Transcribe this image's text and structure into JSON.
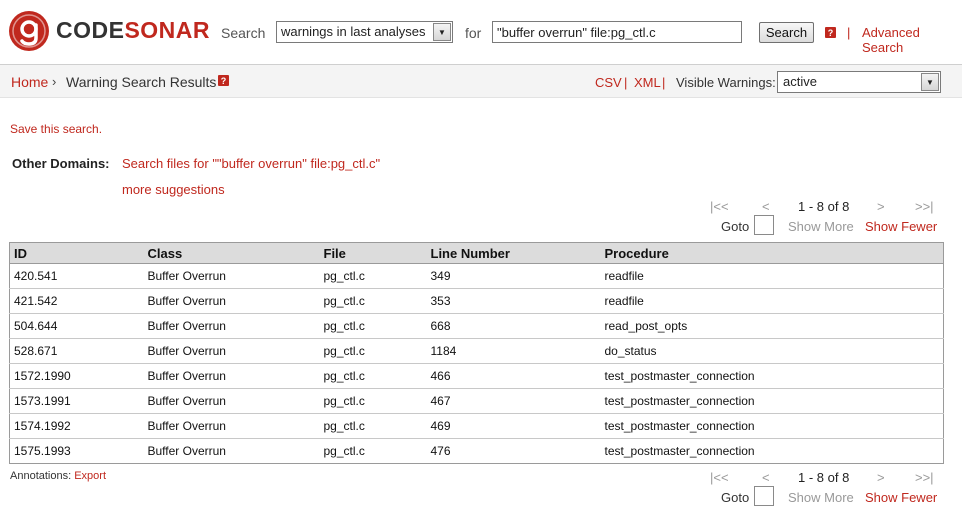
{
  "header": {
    "logo": {
      "part1": "CODE",
      "part2": "SONAR"
    },
    "search_label": "Search",
    "search_scope": "warnings in last analyses",
    "for_label": "for",
    "search_query": "\"buffer overrun\" file:pg_ctl.c",
    "search_button": "Search",
    "help_glyph": "?",
    "separator": "|",
    "advanced_search": "Advanced Search"
  },
  "breadcrumb": {
    "home": "Home",
    "separator": "›",
    "title": "Warning Search Results",
    "help_glyph": "?"
  },
  "toolbar": {
    "csv": "CSV",
    "separator": "|",
    "xml": "XML",
    "visible_label": "Visible Warnings:",
    "visible_value": "active"
  },
  "body": {
    "save_search": "Save this search.",
    "other_domains_label": "Other Domains:",
    "other_domains_link": "Search files for \"\"buffer overrun\" file:pg_ctl.c\"",
    "more_suggestions": "more suggestions"
  },
  "pager": {
    "first": "|<<",
    "prev": "<",
    "range": "1 - 8 of 8",
    "next": ">",
    "last": ">>|",
    "goto_label": "Goto",
    "show_more": "Show More",
    "show_fewer": "Show Fewer"
  },
  "table": {
    "columns": [
      "ID",
      "Class",
      "File",
      "Line Number",
      "Procedure"
    ],
    "rows": [
      [
        "420.541",
        "Buffer Overrun",
        "pg_ctl.c",
        "349",
        "readfile"
      ],
      [
        "421.542",
        "Buffer Overrun",
        "pg_ctl.c",
        "353",
        "readfile"
      ],
      [
        "504.644",
        "Buffer Overrun",
        "pg_ctl.c",
        "668",
        "read_post_opts"
      ],
      [
        "528.671",
        "Buffer Overrun",
        "pg_ctl.c",
        "1184",
        "do_status"
      ],
      [
        "1572.1990",
        "Buffer Overrun",
        "pg_ctl.c",
        "466",
        "test_postmaster_connection"
      ],
      [
        "1573.1991",
        "Buffer Overrun",
        "pg_ctl.c",
        "467",
        "test_postmaster_connection"
      ],
      [
        "1574.1992",
        "Buffer Overrun",
        "pg_ctl.c",
        "469",
        "test_postmaster_connection"
      ],
      [
        "1575.1993",
        "Buffer Overrun",
        "pg_ctl.c",
        "476",
        "test_postmaster_connection"
      ]
    ]
  },
  "annotations": {
    "label": "Annotations:",
    "export": "Export"
  },
  "colors": {
    "accent": "#c0281e",
    "logo_dark": "#333333",
    "header_bg": "#dcdcdc"
  },
  "icons": {
    "logo": "codesonar-logo-icon",
    "help": "help-icon",
    "dropdown": "dropdown-arrow-icon"
  }
}
